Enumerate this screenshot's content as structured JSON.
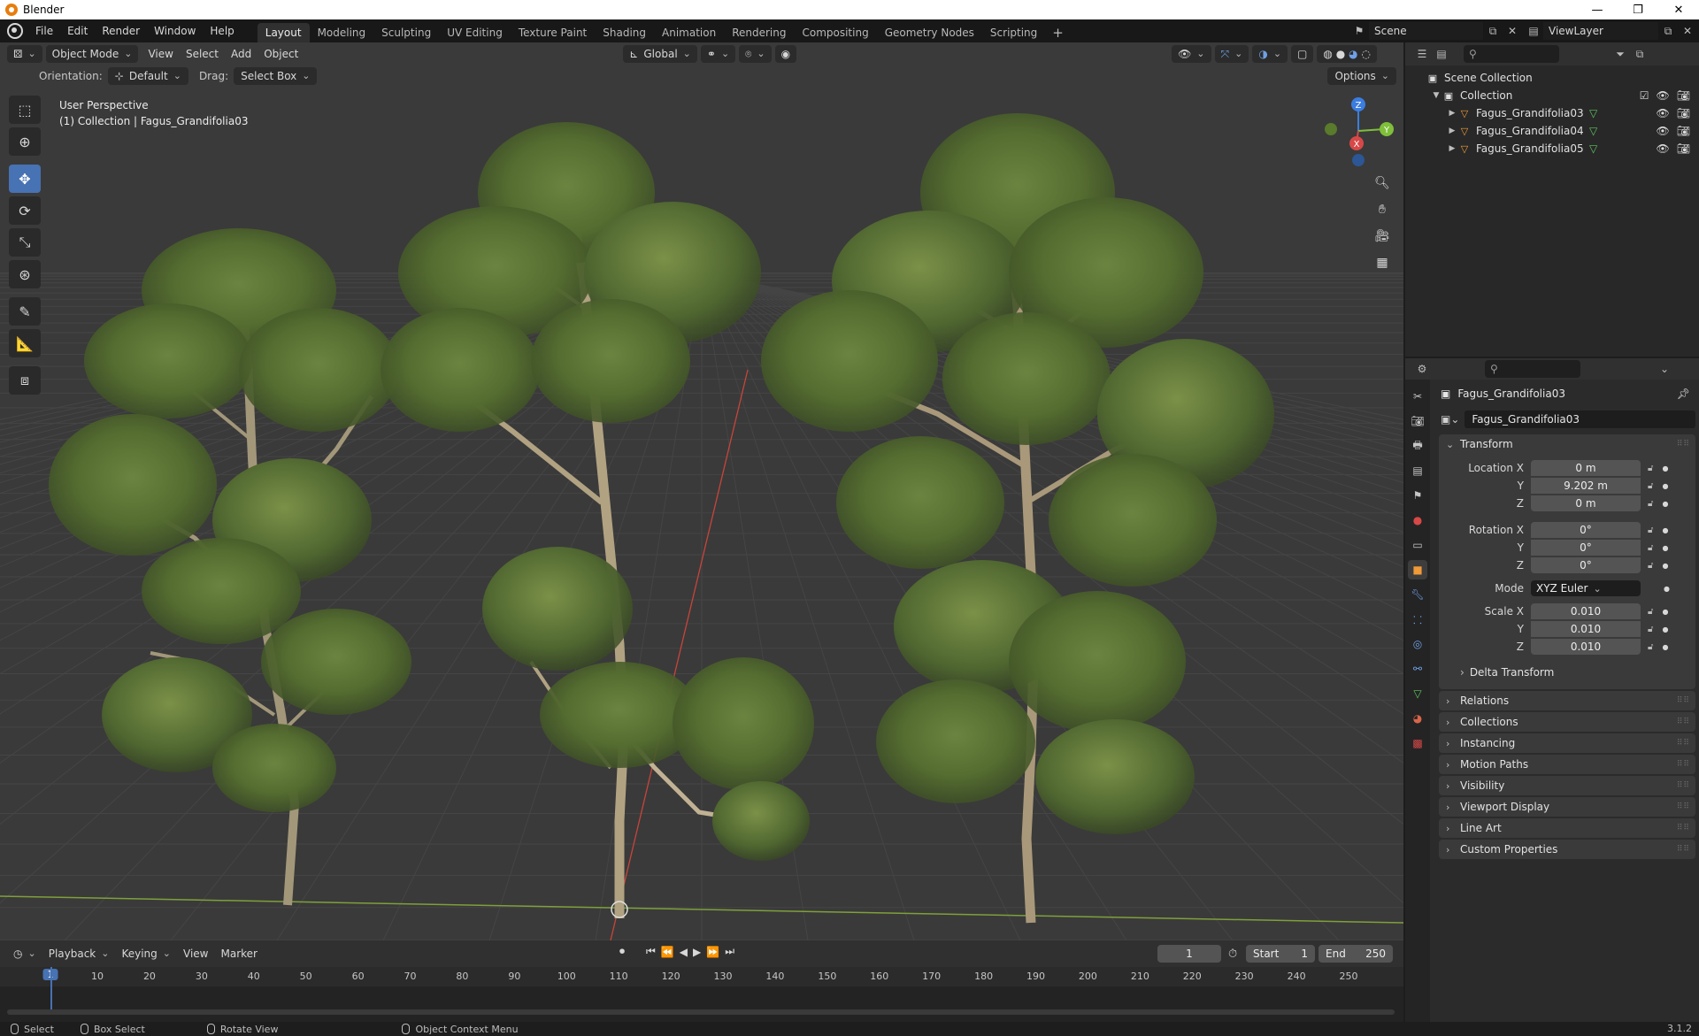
{
  "window": {
    "title": "Blender",
    "controls": [
      "—",
      "❐",
      "✕"
    ]
  },
  "menu": [
    "File",
    "Edit",
    "Render",
    "Window",
    "Help"
  ],
  "workspaces": [
    "Layout",
    "Modeling",
    "Sculpting",
    "UV Editing",
    "Texture Paint",
    "Shading",
    "Animation",
    "Rendering",
    "Compositing",
    "Geometry Nodes",
    "Scripting"
  ],
  "workspace_active": "Layout",
  "workspace_add": "+",
  "scene": {
    "name": "Scene"
  },
  "view_layer": {
    "name": "ViewLayer"
  },
  "viewport": {
    "mode": "Object Mode",
    "menus": [
      "View",
      "Select",
      "Add",
      "Object"
    ],
    "transform_orientation": "Global",
    "orientation_label": "Orientation:",
    "orientation_value": "Default",
    "drag_label": "Drag:",
    "drag_value": "Select Box",
    "options_label": "Options",
    "perspective_label": "User Perspective",
    "collection_info": "(1) Collection | Fagus_Grandifolia03",
    "gizmo_axes": [
      "Z",
      "X",
      "Y"
    ],
    "colors": {
      "bg": "#3a3a3a",
      "grid": "#444444",
      "x_axis": "#d9503f",
      "y_axis": "#8cb33a",
      "tree_leaves": "#5a7034",
      "tree_trunk": "#a89878"
    }
  },
  "tools": [
    "select-box",
    "cursor",
    "move",
    "rotate",
    "scale",
    "transform",
    "annotate",
    "measure",
    "add-cube"
  ],
  "outliner": {
    "root": "Scene Collection",
    "collection": "Collection",
    "objects": [
      "Fagus_Grandifolia03",
      "Fagus_Grandifolia04",
      "Fagus_Grandifolia05"
    ]
  },
  "properties": {
    "object_name": "Fagus_Grandifolia03",
    "object_field": "Fagus_Grandifolia03",
    "transform_title": "Transform",
    "location": {
      "label_x": "Location X",
      "x": "0 m",
      "y": "9.202 m",
      "z": "0 m"
    },
    "rotation": {
      "label_x": "Rotation X",
      "x": "0°",
      "y": "0°",
      "z": "0°"
    },
    "mode_label": "Mode",
    "mode_value": "XYZ Euler",
    "scale": {
      "label_x": "Scale X",
      "x": "0.010",
      "y": "0.010",
      "z": "0.010"
    },
    "axis_labels": {
      "y": "Y",
      "z": "Z"
    },
    "delta_transform": "Delta Transform",
    "panels": [
      "Relations",
      "Collections",
      "Instancing",
      "Motion Paths",
      "Visibility",
      "Viewport Display",
      "Line Art",
      "Custom Properties"
    ]
  },
  "timeline": {
    "menus": [
      "Playback",
      "Keying",
      "View",
      "Marker"
    ],
    "current_frame": "1",
    "start_label": "Start",
    "start": "1",
    "end_label": "End",
    "end": "250",
    "ruler_ticks": [
      "1",
      "10",
      "20",
      "30",
      "40",
      "50",
      "60",
      "70",
      "80",
      "90",
      "100",
      "110",
      "120",
      "130",
      "140",
      "150",
      "160",
      "170",
      "180",
      "190",
      "200",
      "210",
      "220",
      "230",
      "240",
      "250"
    ]
  },
  "statusbar": {
    "items": [
      "Select",
      "Box Select",
      "Rotate View",
      "Object Context Menu"
    ],
    "version": "3.1.2"
  }
}
